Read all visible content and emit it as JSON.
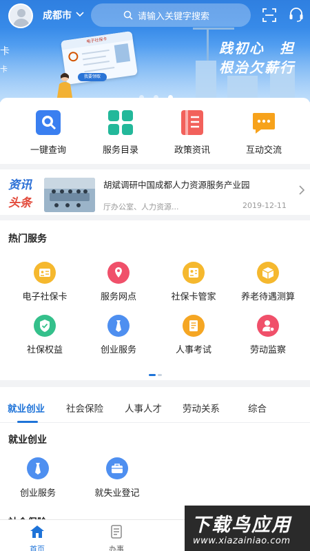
{
  "header": {
    "city": "成都市",
    "search_placeholder": "请输入关键字搜索"
  },
  "banner": {
    "left_char": "卡",
    "left_char_small": "卡",
    "card_title": "电子社保卡",
    "card_button": "我要领取",
    "slogan_line1": "践初心　担",
    "slogan_line2": "根治欠薪行",
    "slide_count": 3,
    "active_slide": 0
  },
  "quick_actions": [
    {
      "label": "一键查询",
      "icon": "search-icon",
      "color": "#3a7ff0"
    },
    {
      "label": "服务目录",
      "icon": "grid-icon",
      "color": "#23b89a"
    },
    {
      "label": "政策资讯",
      "icon": "document-icon",
      "color": "#f2615b"
    },
    {
      "label": "互动交流",
      "icon": "chat-icon",
      "color": "#f7a21b"
    }
  ],
  "news": {
    "logo_line1": "资讯",
    "logo_line2": "头条",
    "title": "胡斌调研中国成都人力资源服务产业园",
    "source": "厅办公室、人力资源...",
    "date": "2019-12-11"
  },
  "hot_services": {
    "title": "热门服务",
    "items": [
      {
        "label": "电子社保卡",
        "icon": "id-card-icon",
        "color": "#f5b82e"
      },
      {
        "label": "服务网点",
        "icon": "location-icon",
        "color": "#f0506a"
      },
      {
        "label": "社保卡管家",
        "icon": "card-manager-icon",
        "color": "#f5b82e"
      },
      {
        "label": "养老待遇测算",
        "icon": "box-icon",
        "color": "#f5b82e"
      },
      {
        "label": "社保权益",
        "icon": "shield-icon",
        "color": "#34c08b"
      },
      {
        "label": "创业服务",
        "icon": "tie-icon",
        "color": "#4e8ff0"
      },
      {
        "label": "人事考试",
        "icon": "exam-icon",
        "color": "#f5a623"
      },
      {
        "label": "劳动监察",
        "icon": "inspector-icon",
        "color": "#f0506a"
      }
    ]
  },
  "tabs": [
    {
      "label": "就业创业",
      "active": true
    },
    {
      "label": "社会保险",
      "active": false
    },
    {
      "label": "人事人才",
      "active": false
    },
    {
      "label": "劳动关系",
      "active": false
    },
    {
      "label": "综合",
      "active": false
    }
  ],
  "section": {
    "title": "就业创业",
    "items": [
      {
        "label": "创业服务",
        "icon": "tie-icon",
        "color": "#4e8ff0"
      },
      {
        "label": "就失业登记",
        "icon": "briefcase-icon",
        "color": "#4e8ff0"
      }
    ],
    "next_title": "社会保险"
  },
  "bottom_nav": [
    {
      "label": "首页",
      "icon": "home-icon",
      "active": true
    },
    {
      "label": "办事",
      "icon": "task-icon",
      "active": false
    }
  ],
  "watermark": {
    "title": "下载鸟应用",
    "url": "www.xiazainiao.com"
  },
  "colors": {
    "accent": "#1e73d8",
    "banner_top": "#2f7fe0"
  }
}
